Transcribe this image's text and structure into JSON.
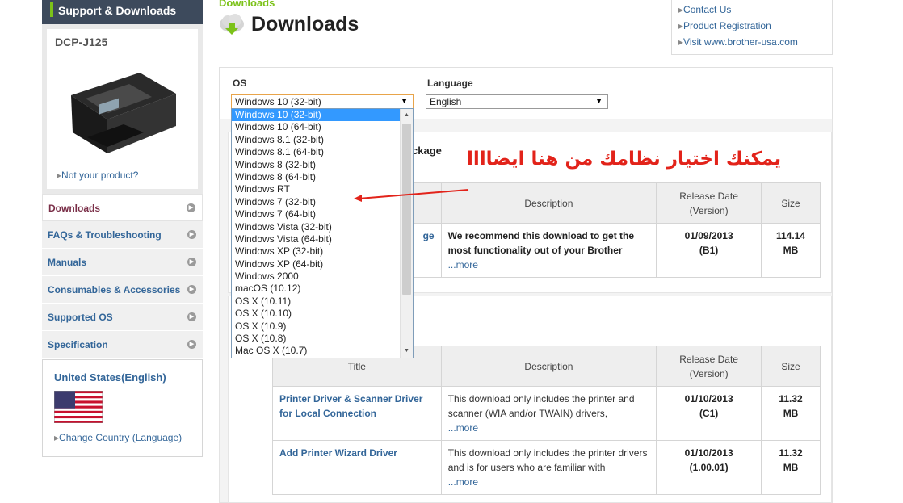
{
  "sidebar": {
    "header": "Support & Downloads",
    "product_name": "DCP-J125",
    "not_product_link": "Not your product?",
    "menu": [
      {
        "label": "Downloads"
      },
      {
        "label": "FAQs & Troubleshooting"
      },
      {
        "label": "Manuals"
      },
      {
        "label": "Consumables & Accessories"
      },
      {
        "label": "Supported OS"
      },
      {
        "label": "Specification"
      }
    ],
    "country_title": "United States(English)",
    "change_country": "Change Country (Language)"
  },
  "header": {
    "breadcrumb": "Downloads",
    "title": "Downloads",
    "links": [
      "Contact Us",
      "Product Registration",
      "Visit www.brother-usa.com"
    ]
  },
  "filters": {
    "os_label": "OS",
    "os_value": "Windows 10 (32-bit)",
    "language_label": "Language",
    "language_value": "English"
  },
  "os_options": [
    "Windows 10 (32-bit)",
    "Windows 10 (64-bit)",
    "Windows 8.1 (32-bit)",
    "Windows 8.1 (64-bit)",
    "Windows 8 (32-bit)",
    "Windows 8 (64-bit)",
    "Windows RT",
    "Windows 7 (32-bit)",
    "Windows 7 (64-bit)",
    "Windows Vista (32-bit)",
    "Windows Vista (64-bit)",
    "Windows XP (32-bit)",
    "Windows XP (64-bit)",
    "Windows 2000",
    "macOS (10.12)",
    "OS X (10.11)",
    "OS X (10.10)",
    "OS X (10.9)",
    "OS X (10.8)",
    "Mac OS X (10.7)"
  ],
  "section1": {
    "title_fragment": "ckage",
    "headers": {
      "description": "Description",
      "release": "Release Date\n(Version)",
      "size": "Size"
    },
    "row": {
      "title_fragment": "ge",
      "description": "We recommend this download to get the most functionality out of your Brother",
      "more": "...more",
      "date": "01/09/2013",
      "version": "(B1)",
      "size_value": "114.14",
      "size_unit": "MB"
    }
  },
  "section2": {
    "headers": {
      "title": "Title",
      "description": "Description",
      "release": "Release Date\n(Version)",
      "size": "Size"
    },
    "rows": [
      {
        "title": "Printer Driver & Scanner Driver for Local Connection",
        "description": "This download only includes the printer and scanner (WIA and/or TWAIN) drivers,",
        "more": "...more",
        "date": "01/10/2013",
        "version": "(C1)",
        "size_value": "11.32",
        "size_unit": "MB"
      },
      {
        "title": "Add Printer Wizard Driver",
        "description": "This download only includes the printer drivers and is for users who are familiar with",
        "more": "...more",
        "date": "01/10/2013",
        "version": "(1.00.01)",
        "size_value": "11.32",
        "size_unit": "MB"
      }
    ]
  },
  "annotation": "يمكنك اختيار نظامك من هنا ايضاااا",
  "colors": {
    "accent_green": "#7cc219",
    "link_blue": "#336699",
    "annotation_red": "#e2231a",
    "selected_blue": "#3399ff"
  }
}
